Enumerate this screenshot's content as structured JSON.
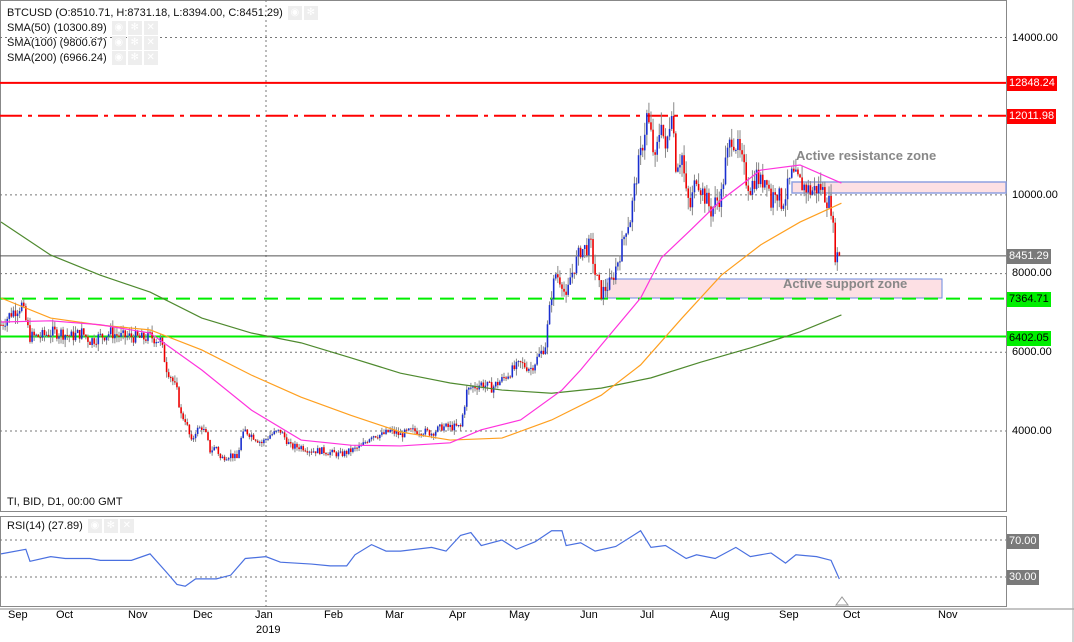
{
  "header": {
    "symbol_line": "BTCUSD (O:8510.71, H:8731.18, L:8394.00, C:8451.29)",
    "indicators": [
      "SMA(50) (10300.89)",
      "SMA(100) (9800.67)",
      "SMA(200) (6966.24)"
    ],
    "footer": "TI, BID, D1, 00:00 GMT"
  },
  "rsi": {
    "label": "RSI(14) (27.89)",
    "levels": [
      "70.00",
      "30.00"
    ]
  },
  "price_axis": [
    "14000.00",
    "10000.00",
    "8000.00",
    "6000.00",
    "4000.00"
  ],
  "levels": [
    {
      "value": 12848.24,
      "label": "12848.24",
      "color": "#ff0000",
      "style": "solid"
    },
    {
      "value": 12011.98,
      "label": "12011.98",
      "color": "#ff0000",
      "style": "dashdot"
    },
    {
      "value": 8451.29,
      "label": "8451.29",
      "color": "#cc0000",
      "style": "thin"
    },
    {
      "value": 7364.71,
      "label": "7364.71",
      "color": "#00ee00",
      "style": "dash"
    },
    {
      "value": 6402.05,
      "label": "6402.05",
      "color": "#00ee00",
      "style": "solid"
    }
  ],
  "zones": {
    "resistance": "Active resistance zone",
    "support": "Active support zone"
  },
  "time_axis": {
    "months": [
      "Sep",
      "Oct",
      "Nov",
      "Dec",
      "Jan",
      "Feb",
      "Mar",
      "Apr",
      "May",
      "Jun",
      "Jul",
      "Aug",
      "Sep",
      "Oct",
      "Nov"
    ],
    "year": "2019"
  },
  "chart_data": {
    "type": "candlestick",
    "title": "BTCUSD D1",
    "closes_day_value": [
      [
        0,
        6700
      ],
      [
        5,
        7000
      ],
      [
        10,
        7200
      ],
      [
        14,
        6400
      ],
      [
        19,
        6400
      ],
      [
        24,
        6500
      ],
      [
        29,
        6500
      ],
      [
        34,
        6400
      ],
      [
        39,
        6500
      ],
      [
        43,
        6300
      ],
      [
        48,
        6400
      ],
      [
        53,
        6500
      ],
      [
        58,
        6400
      ],
      [
        63,
        6400
      ],
      [
        68,
        6350
      ],
      [
        72,
        6400
      ],
      [
        77,
        6300
      ],
      [
        80,
        5600
      ],
      [
        82,
        5400
      ],
      [
        85,
        5000
      ],
      [
        87,
        4400
      ],
      [
        89,
        4300
      ],
      [
        92,
        3700
      ],
      [
        94,
        4000
      ],
      [
        97,
        4100
      ],
      [
        99,
        3900
      ],
      [
        101,
        3500
      ],
      [
        104,
        3600
      ],
      [
        106,
        3300
      ],
      [
        111,
        3400
      ],
      [
        114,
        3300
      ],
      [
        116,
        3800
      ],
      [
        118,
        4000
      ],
      [
        121,
        3900
      ],
      [
        126,
        3700
      ],
      [
        130,
        3900
      ],
      [
        135,
        4000
      ],
      [
        140,
        3600
      ],
      [
        145,
        3600
      ],
      [
        150,
        3500
      ],
      [
        155,
        3500
      ],
      [
        159,
        3450
      ],
      [
        164,
        3400
      ],
      [
        169,
        3500
      ],
      [
        174,
        3600
      ],
      [
        179,
        3900
      ],
      [
        184,
        3900
      ],
      [
        188,
        4000
      ],
      [
        193,
        3900
      ],
      [
        198,
        4000
      ],
      [
        203,
        4000
      ],
      [
        208,
        3950
      ],
      [
        213,
        4100
      ],
      [
        217,
        4100
      ],
      [
        222,
        4100
      ],
      [
        225,
        5000
      ],
      [
        227,
        5100
      ],
      [
        232,
        5200
      ],
      [
        237,
        5100
      ],
      [
        242,
        5300
      ],
      [
        246,
        5500
      ],
      [
        251,
        5700
      ],
      [
        256,
        5600
      ],
      [
        261,
        6000
      ],
      [
        263,
        6200
      ],
      [
        266,
        7500
      ],
      [
        268,
        8000
      ],
      [
        271,
        7800
      ],
      [
        273,
        7300
      ],
      [
        275,
        7900
      ],
      [
        280,
        8600
      ],
      [
        285,
        8700
      ],
      [
        287,
        8000
      ],
      [
        290,
        7500
      ],
      [
        295,
        7800
      ],
      [
        300,
        8700
      ],
      [
        302,
        9200
      ],
      [
        304,
        9400
      ],
      [
        307,
        10500
      ],
      [
        309,
        11000
      ],
      [
        312,
        12000
      ],
      [
        314,
        11500
      ],
      [
        316,
        10800
      ],
      [
        319,
        12000
      ],
      [
        321,
        11000
      ],
      [
        324,
        12300
      ],
      [
        326,
        10800
      ],
      [
        329,
        11000
      ],
      [
        331,
        10000
      ],
      [
        333,
        9700
      ],
      [
        336,
        10500
      ],
      [
        338,
        10200
      ],
      [
        343,
        9600
      ],
      [
        345,
        9800
      ],
      [
        348,
        10000
      ],
      [
        350,
        10800
      ],
      [
        353,
        11500
      ],
      [
        355,
        11300
      ],
      [
        357,
        11000
      ],
      [
        360,
        10400
      ],
      [
        362,
        10200
      ],
      [
        365,
        10500
      ],
      [
        367,
        10300
      ],
      [
        370,
        10500
      ],
      [
        372,
        9800
      ],
      [
        374,
        10200
      ],
      [
        377,
        9800
      ],
      [
        379,
        10000
      ],
      [
        382,
        10500
      ],
      [
        386,
        10300
      ],
      [
        391,
        10100
      ],
      [
        396,
        10200
      ],
      [
        401,
        9700
      ],
      [
        403,
        8500
      ],
      [
        405,
        8451.29
      ]
    ],
    "sma50": [
      [
        0,
        6770
      ],
      [
        24,
        6800
      ],
      [
        48,
        6700
      ],
      [
        72,
        6490
      ],
      [
        97,
        5550
      ],
      [
        121,
        4530
      ],
      [
        145,
        3770
      ],
      [
        169,
        3640
      ],
      [
        193,
        3620
      ],
      [
        217,
        3700
      ],
      [
        232,
        4030
      ],
      [
        251,
        4280
      ],
      [
        271,
        5040
      ],
      [
        280,
        5550
      ],
      [
        290,
        6185
      ],
      [
        309,
        7380
      ],
      [
        319,
        8400
      ],
      [
        333,
        9100
      ],
      [
        348,
        9870
      ],
      [
        367,
        10630
      ],
      [
        386,
        10760
      ],
      [
        406,
        10300
      ]
    ],
    "sma100": [
      [
        0,
        7380
      ],
      [
        24,
        6870
      ],
      [
        48,
        6690
      ],
      [
        72,
        6570
      ],
      [
        97,
        6060
      ],
      [
        121,
        5420
      ],
      [
        145,
        4860
      ],
      [
        169,
        4400
      ],
      [
        193,
        3975
      ],
      [
        217,
        3770
      ],
      [
        242,
        3820
      ],
      [
        266,
        4280
      ],
      [
        290,
        4910
      ],
      [
        309,
        5680
      ],
      [
        329,
        6870
      ],
      [
        348,
        7960
      ],
      [
        367,
        8730
      ],
      [
        386,
        9310
      ],
      [
        406,
        9790
      ]
    ],
    "sma200": [
      [
        0,
        9310
      ],
      [
        24,
        8470
      ],
      [
        48,
        7960
      ],
      [
        72,
        7530
      ],
      [
        97,
        6870
      ],
      [
        121,
        6490
      ],
      [
        145,
        6240
      ],
      [
        169,
        5860
      ],
      [
        193,
        5470
      ],
      [
        217,
        5220
      ],
      [
        242,
        5040
      ],
      [
        266,
        4960
      ],
      [
        290,
        5090
      ],
      [
        314,
        5350
      ],
      [
        338,
        5750
      ],
      [
        362,
        6110
      ],
      [
        386,
        6520
      ],
      [
        406,
        6950
      ]
    ],
    "rsi14": [
      [
        0,
        55
      ],
      [
        12,
        60
      ],
      [
        14,
        47
      ],
      [
        24,
        52
      ],
      [
        31,
        50
      ],
      [
        43,
        50
      ],
      [
        48,
        48
      ],
      [
        63,
        48
      ],
      [
        72,
        55
      ],
      [
        80,
        35
      ],
      [
        85,
        22
      ],
      [
        89,
        20
      ],
      [
        94,
        28
      ],
      [
        104,
        28
      ],
      [
        111,
        32
      ],
      [
        118,
        50
      ],
      [
        128,
        52
      ],
      [
        135,
        46
      ],
      [
        150,
        44
      ],
      [
        159,
        42
      ],
      [
        167,
        42
      ],
      [
        171,
        54
      ],
      [
        179,
        65
      ],
      [
        186,
        58
      ],
      [
        193,
        58
      ],
      [
        208,
        62
      ],
      [
        215,
        58
      ],
      [
        222,
        75
      ],
      [
        227,
        78
      ],
      [
        232,
        64
      ],
      [
        242,
        70
      ],
      [
        249,
        60
      ],
      [
        258,
        68
      ],
      [
        266,
        80
      ],
      [
        271,
        80
      ],
      [
        273,
        64
      ],
      [
        280,
        67
      ],
      [
        287,
        58
      ],
      [
        297,
        63
      ],
      [
        309,
        80
      ],
      [
        314,
        62
      ],
      [
        321,
        64
      ],
      [
        331,
        50
      ],
      [
        336,
        54
      ],
      [
        345,
        50
      ],
      [
        355,
        62
      ],
      [
        362,
        52
      ],
      [
        372,
        56
      ],
      [
        379,
        45
      ],
      [
        384,
        54
      ],
      [
        394,
        52
      ],
      [
        401,
        48
      ],
      [
        405,
        27.89
      ]
    ],
    "ylim": [
      2900,
      14700
    ],
    "rsi_ylim": [
      0,
      100
    ]
  }
}
